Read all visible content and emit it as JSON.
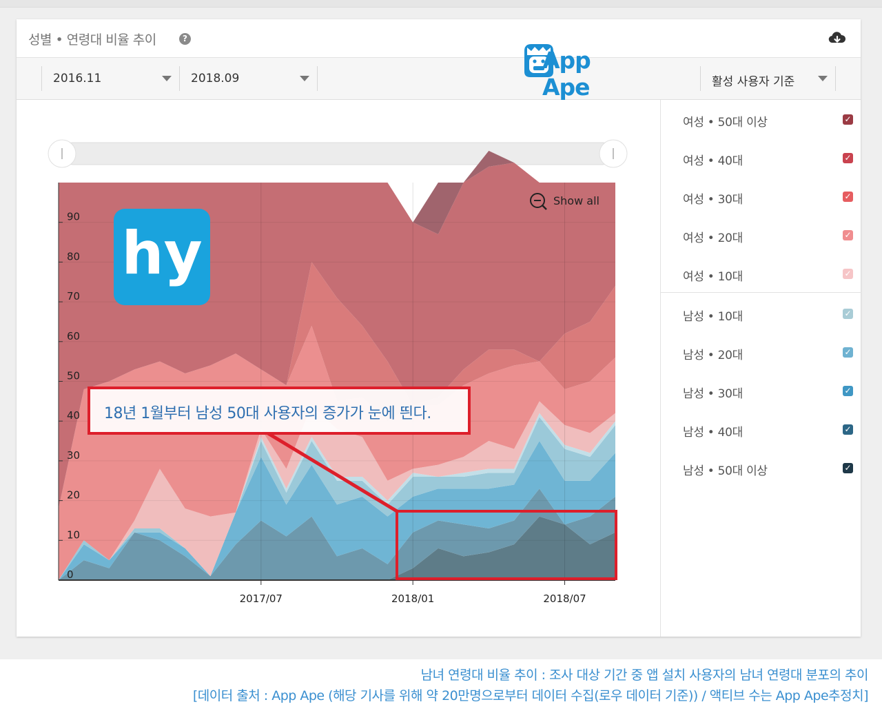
{
  "card": {
    "title": "성별 • 연령대 비율 추이",
    "help_icon": "question-circle-icon",
    "download_icon": "cloud-download-icon"
  },
  "toolbar": {
    "start_date": "2016.11",
    "end_date": "2018.09",
    "basis": "활성 사용자 기준",
    "brand": "App Ape"
  },
  "chart": {
    "show_all_label": "Show all",
    "overlay_logo_text": "hy",
    "callout": "18년 1월부터 남성 50대 사용자의 증가가 눈에 띈다."
  },
  "chart_data": {
    "type": "area",
    "stacked": true,
    "x": [
      "2016.11",
      "2016.12",
      "2017.01",
      "2017.02",
      "2017.03",
      "2017.04",
      "2017.05",
      "2017.06",
      "2017.07",
      "2017.08",
      "2017.09",
      "2017.10",
      "2017.11",
      "2017.12",
      "2018.01",
      "2018.02",
      "2018.03",
      "2018.04",
      "2018.05",
      "2018.06",
      "2018.07",
      "2018.08",
      "2018.09"
    ],
    "x_tick_labels": [
      "2017/07",
      "2018/01",
      "2018/07"
    ],
    "y_ticks": [
      "0",
      "10",
      "20",
      "30",
      "40",
      "50",
      "60",
      "70",
      "80",
      "90"
    ],
    "ylim": [
      0,
      100
    ],
    "series": [
      {
        "name": "남성 • 50대 이상",
        "color": "#5e7c88",
        "values": [
          0,
          0,
          0,
          0,
          0,
          0,
          0,
          0,
          0,
          0,
          0,
          0,
          0,
          0,
          3,
          8,
          6,
          7,
          9,
          16,
          14,
          9,
          12
        ]
      },
      {
        "name": "남성 • 40대",
        "color": "#6d99ad",
        "values": [
          0,
          5,
          3,
          12,
          10,
          6,
          1,
          9,
          15,
          11,
          16,
          6,
          8,
          4,
          9,
          7,
          8,
          6,
          6,
          7,
          0,
          7,
          9
        ]
      },
      {
        "name": "남성 • 30대",
        "color": "#6fb5d4",
        "values": [
          0,
          4,
          2,
          0,
          2,
          2,
          0,
          8,
          16,
          8,
          13,
          13,
          13,
          12,
          9,
          8,
          9,
          10,
          9,
          12,
          11,
          9,
          11
        ]
      },
      {
        "name": "남성 • 20대",
        "color": "#9bc9d9",
        "values": [
          0,
          1,
          0,
          1,
          1,
          0,
          0,
          0,
          4,
          3,
          6,
          6,
          4,
          3,
          5,
          3,
          3,
          4,
          3,
          6,
          8,
          6,
          7
        ]
      },
      {
        "name": "남성 • 10대",
        "color": "#c3dfe8",
        "values": [
          0,
          0,
          0,
          0,
          0,
          0,
          0,
          0,
          1,
          1,
          1,
          1,
          1,
          1,
          1,
          0,
          1,
          1,
          1,
          1,
          1,
          1,
          1
        ]
      },
      {
        "name": "여성 • 10대",
        "color": "#f0bdbd",
        "values": [
          0,
          0,
          0,
          2,
          15,
          10,
          15,
          0,
          2,
          5,
          8,
          12,
          10,
          5,
          1,
          3,
          4,
          7,
          5,
          3,
          5,
          5,
          2
        ]
      },
      {
        "name": "여성 • 20대",
        "color": "#eb8f8f",
        "values": [
          18,
          38,
          45,
          38,
          27,
          34,
          38,
          40,
          15,
          21,
          20,
          7,
          10,
          15,
          16,
          15,
          18,
          17,
          21,
          10,
          9,
          13,
          14
        ]
      },
      {
        "name": "여성 • 30대",
        "color": "#d97b7b",
        "values": [
          0,
          0,
          0,
          0,
          0,
          0,
          0,
          0,
          0,
          0,
          16,
          26,
          18,
          15,
          0,
          2,
          4,
          6,
          4,
          0,
          14,
          15,
          18
        ]
      },
      {
        "name": "여성 • 40대",
        "color": "#c56e74",
        "values": [
          82,
          52,
          50,
          47,
          45,
          48,
          46,
          43,
          47,
          51,
          20,
          29,
          36,
          45,
          46,
          41,
          47,
          46,
          47,
          45,
          38,
          35,
          26
        ]
      },
      {
        "name": "여성 • 50대 이상",
        "color": "#a0646d",
        "values": [
          0,
          0,
          0,
          0,
          0,
          0,
          0,
          0,
          0,
          0,
          0,
          0,
          0,
          0,
          0,
          13,
          0,
          4,
          0,
          0,
          0,
          0,
          0
        ]
      }
    ]
  },
  "legend": [
    {
      "label": "여성 • 50대 이상",
      "color": "#9b3b44"
    },
    {
      "label": "여성 • 40대",
      "color": "#c9434f"
    },
    {
      "label": "여성 • 30대",
      "color": "#e65d60"
    },
    {
      "label": "여성 • 20대",
      "color": "#f08d8f"
    },
    {
      "label": "여성 • 10대",
      "color": "#f6c5c7"
    },
    {
      "label": "남성 • 10대",
      "color": "#a9ccd6"
    },
    {
      "label": "남성 • 20대",
      "color": "#6fb2d1"
    },
    {
      "label": "남성 • 30대",
      "color": "#3f97c4"
    },
    {
      "label": "남성 • 40대",
      "color": "#2c6686"
    },
    {
      "label": "남성 • 50대 이상",
      "color": "#1e3848"
    }
  ],
  "caption": {
    "line1": "남녀 연령대 비율 추이 : 조사 대상 기간 중 앱 설치 사용자의 남녀 연령대 분포의 추이",
    "line2": "[데이터 출처 : App Ape (해당 기사를 위해 약 20만명으로부터 데이터 수집(로우 데이터 기준)) / 액티브 수는 App Ape추정치]"
  }
}
